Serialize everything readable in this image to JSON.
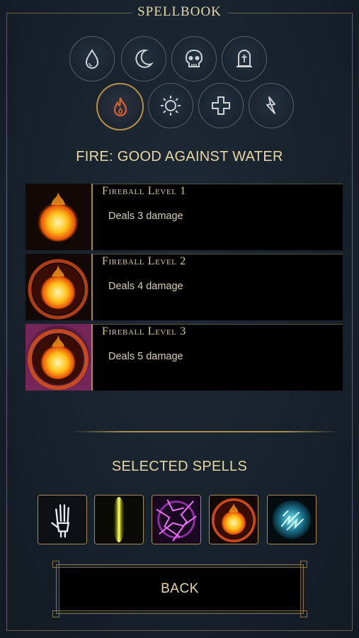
{
  "title": "SPELLBOOK",
  "categories": [
    {
      "icon": "water-drop-icon",
      "active": false
    },
    {
      "icon": "moon-icon",
      "active": false
    },
    {
      "icon": "skull-icon",
      "active": false
    },
    {
      "icon": "tombstone-icon",
      "active": false
    },
    {
      "icon": "fire-icon",
      "active": true
    },
    {
      "icon": "sun-icon",
      "active": false
    },
    {
      "icon": "cross-icon",
      "active": false
    },
    {
      "icon": "lightning-icon",
      "active": false
    }
  ],
  "category_heading": "FIRE: GOOD AGAINST WATER",
  "spells": [
    {
      "name": "Fireball Level 1",
      "description": "Deals 3 damage",
      "icon": "fireball-icon"
    },
    {
      "name": "Fireball Level 2",
      "description": "Deals 4 damage",
      "icon": "fireball-ringed-icon"
    },
    {
      "name": "Fireball Level 3",
      "description": "Deals 5 damage",
      "icon": "fireball-charged-icon"
    }
  ],
  "selected_heading": "SELECTED SPELLS",
  "selected_spells": [
    {
      "icon": "skeleton-hand-icon"
    },
    {
      "icon": "light-beam-icon"
    },
    {
      "icon": "purple-lightning-icon"
    },
    {
      "icon": "fireball-ringed-icon"
    },
    {
      "icon": "ice-orb-icon"
    }
  ],
  "back_label": "BACK",
  "colors": {
    "accent_gold": "#a88c54",
    "text_gold": "#e8d6a4",
    "background": "#18222d"
  }
}
